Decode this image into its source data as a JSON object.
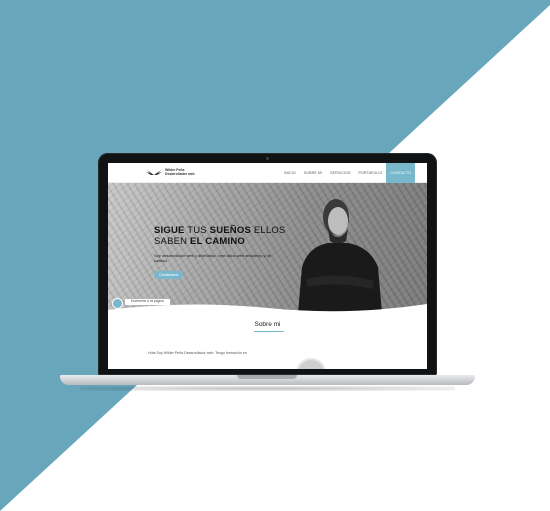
{
  "colors": {
    "teal": "#68a6bc",
    "white": "#ffffff",
    "accent": "#79b8cc"
  },
  "site": {
    "logo": {
      "icon": "wings-icon",
      "line1": "Wilder Peña",
      "line2": "Desarrollador web"
    },
    "nav": [
      "INICIO",
      "SOBRE MI",
      "SERVICIOS",
      "PORTAFOLIO",
      "CONTACTO"
    ],
    "nav_active_index": 4,
    "hero": {
      "headline_1_strong": "SIGUE",
      "headline_1_rest": " TUS ",
      "headline_1_strong2": "SUEÑOS",
      "headline_1_rest2": " ELLOS",
      "headline_2_rest": "SABEN ",
      "headline_2_strong": "EL CAMINO",
      "subtitle": "Soy desarrollador web y diseñador, creo sitios web atractivos y de calidad",
      "cta": "Contáctame",
      "chat_icon": "chat-icon",
      "chat_label": "Escríbeme a mi página"
    },
    "about": {
      "title": "Sobre mi",
      "intro": "Hola Soy Wilder Peña Desarrollador web. Tengo formación en"
    }
  }
}
